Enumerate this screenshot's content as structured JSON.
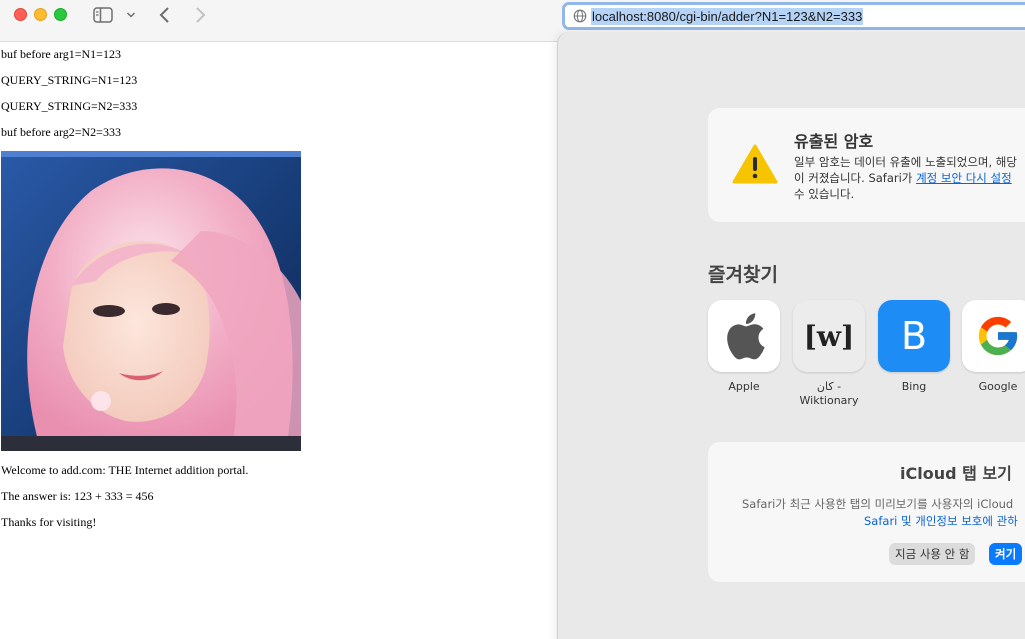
{
  "toolbar": {
    "url": "localhost:8080/cgi-bin/adder?N1=123&N2=333"
  },
  "page": {
    "lines_top": [
      "buf before arg1=N1=123",
      "QUERY_STRING=N1=123",
      "QUERY_STRING=N2=333",
      "buf before arg2=N2=333"
    ],
    "lines_bottom": [
      "Welcome to add.com: THE Internet addition portal.",
      "The answer is: 123 + 333 = 456",
      "Thanks for visiting!"
    ]
  },
  "popover": {
    "password_card": {
      "title": "유출된 암호",
      "line1": "일부 암호는 데이터 유출에 노출되었으며, 해당",
      "line2_prefix": "이 커졌습니다. Safari가 ",
      "line2_link": "계정 보안 다시 설정",
      "line3": "수 있습니다."
    },
    "favorites_title": "즐겨찾기",
    "favorites": [
      {
        "label": "Apple",
        "icon": "apple-logo"
      },
      {
        "label": "كان - Wiktionary",
        "icon": "wiktionary-logo",
        "tile_text": "[w]"
      },
      {
        "label": "Bing",
        "icon": "bing-logo",
        "tile_text": "B"
      },
      {
        "label": "Google",
        "icon": "google-logo"
      }
    ],
    "icloud_card": {
      "title": "iCloud 탭 보기",
      "body": "Safari가 최근 사용한 탭의 미리보기를 사용자의 iCloud",
      "link": "Safari 및 개인정보 보호에 관하",
      "button_off": "지금 사용 안 함",
      "button_on": "켜기"
    }
  },
  "colors": {
    "accent": "#0a7aff",
    "link": "#0a64d6",
    "url_highlight": "#b4d3f7",
    "bing_tile": "#1e8cf5"
  }
}
